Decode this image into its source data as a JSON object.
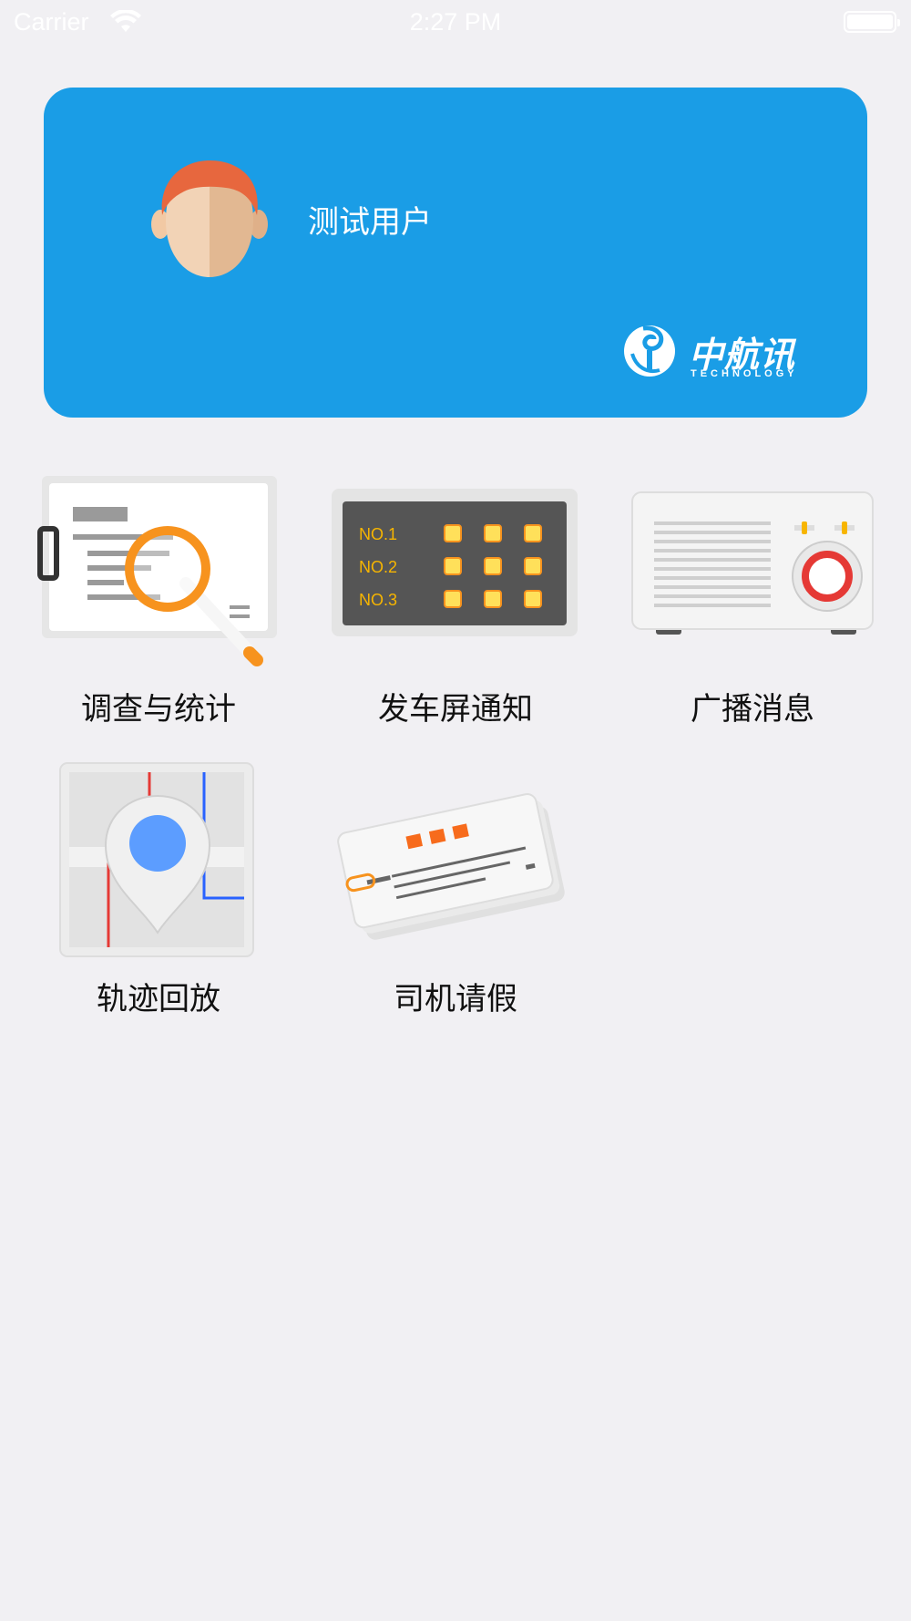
{
  "status_bar": {
    "carrier": "Carrier",
    "time": "2:27 PM"
  },
  "user_card": {
    "user_name": "测试用户",
    "brand_name": "中航讯",
    "brand_sub": "TECHNOLOGY",
    "background_color": "#1a9de6"
  },
  "menu": {
    "items": [
      {
        "label": "调查与统计",
        "icon": "survey-magnifier-icon"
      },
      {
        "label": "发车屏通知",
        "icon": "departure-screen-icon"
      },
      {
        "label": "广播消息",
        "icon": "radio-icon"
      },
      {
        "label": "轨迹回放",
        "icon": "map-pin-icon"
      },
      {
        "label": "司机请假",
        "icon": "leave-cards-icon"
      }
    ],
    "screen_rows": [
      "NO.1",
      "NO.2",
      "NO.3"
    ]
  }
}
